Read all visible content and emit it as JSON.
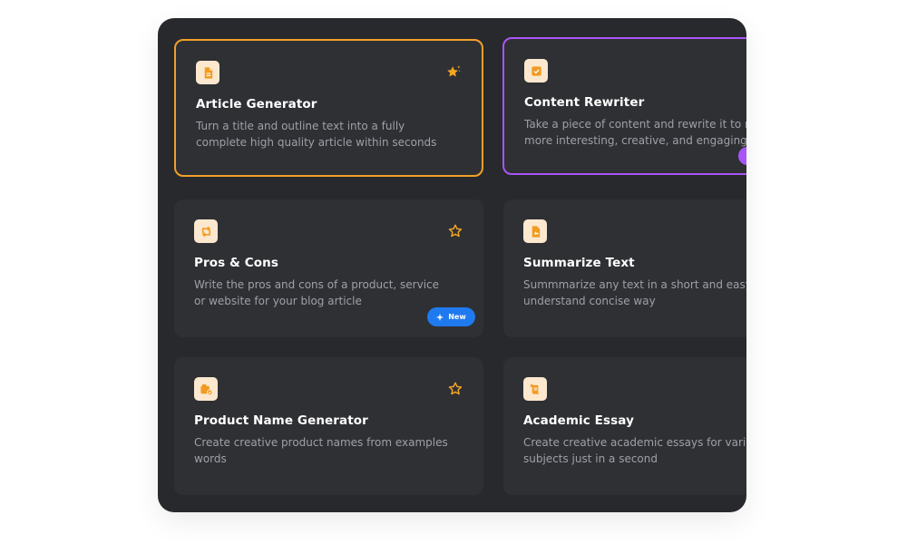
{
  "colors": {
    "panel_bg": "#28292d",
    "card_bg": "#2f3034",
    "accent_orange": "#f0a028",
    "accent_purple": "#a855f7",
    "badge_blue": "#1f7af0",
    "icon_bg": "#fbe8cf"
  },
  "cards": [
    {
      "title": "Article Generator",
      "description": "Turn a title and outline text into a fully complete high quality article within seconds",
      "icon": "document-icon",
      "favorite": "star-filled-sparkle-icon",
      "state": "selected-orange"
    },
    {
      "title": "Content Rewriter",
      "description": "Take a piece of content and rewrite it to m more interesting, creative, and engaging",
      "icon": "checklist-icon",
      "state": "selected-purple"
    },
    {
      "title": "Pros & Cons",
      "description": "Write the pros and cons of a product, service or website for your blog article",
      "icon": "swap-arrows-icon",
      "favorite": "star-outline-icon",
      "badge": "New"
    },
    {
      "title": "Summarize Text",
      "description": "Summmarize any text in a short and easy understand concise way",
      "icon": "document-summary-icon"
    },
    {
      "title": "Product Name Generator",
      "description": "Create creative product names from examples words",
      "icon": "product-box-icon",
      "favorite": "star-outline-icon"
    },
    {
      "title": "Academic Essay",
      "description": "Create creative academic essays for vario subjects just in a second",
      "icon": "scroll-icon"
    }
  ]
}
